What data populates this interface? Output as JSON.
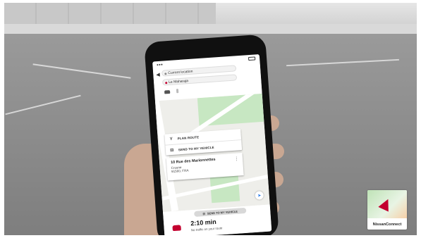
{
  "phone": {
    "search": {
      "from": "Current location",
      "to": "Le Maharaja"
    },
    "menu": [
      {
        "label": "PLAN ROUTE"
      },
      {
        "label": "SEND TO MY VEHICLE"
      }
    ],
    "address": {
      "line1": "10 Rue des Marionnettes",
      "line2": "Crosne",
      "line3": "91560, FRA"
    },
    "send_button_label": "SEND TO MY VEHICLE",
    "eta": {
      "time": "2:10 min",
      "subtitle": "No traffic on your route"
    }
  },
  "logo": {
    "text": "NissanConnect"
  },
  "colors": {
    "accent": "#c3002f",
    "park": "#c7e7c2",
    "map_bg": "#eeeeea"
  }
}
